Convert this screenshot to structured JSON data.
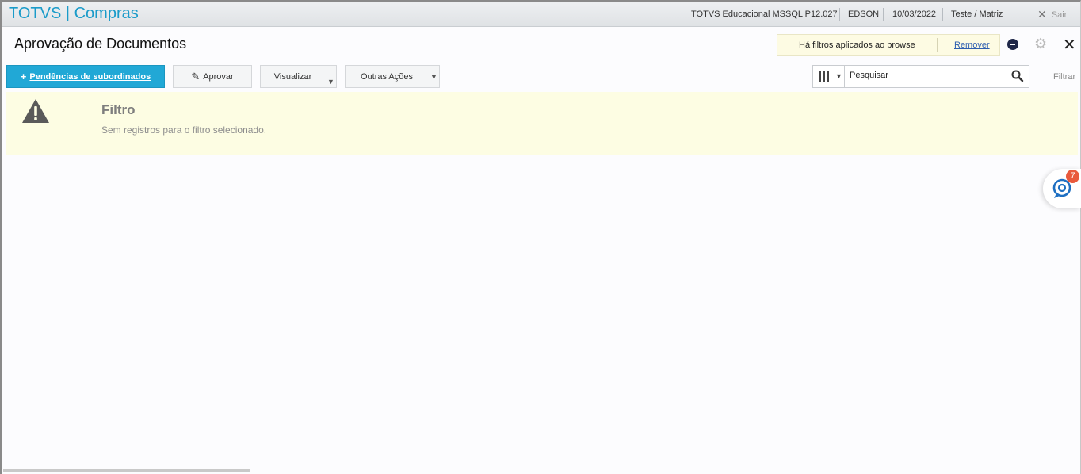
{
  "header": {
    "app_title": "TOTVS | Compras",
    "environment": "TOTVS Educacional MSSQL P12.027",
    "user": "EDSON",
    "date": "10/03/2022",
    "company": "Teste / Matriz",
    "exit_label": "Sair"
  },
  "page": {
    "title": "Aprovação de Documentos",
    "filter_notice": "Há filtros aplicados ao browse",
    "remove_link": "Remover"
  },
  "toolbar": {
    "pending_label": "Pendências de subordinados",
    "approve_label": "Aprovar",
    "view_label": "Visualizar",
    "other_actions_label": "Outras Ações"
  },
  "search": {
    "value": "Pesquisar",
    "filter_label": "Filtrar"
  },
  "banner": {
    "title": "Filtro",
    "message": "Sem registros para o filtro selecionado."
  },
  "chat": {
    "badge_count": "7"
  },
  "colors": {
    "brand": "#1a9bc9",
    "primary_button": "#21a8d6",
    "banner_background": "#fdfde3",
    "badge": "#e95a3d"
  },
  "icons": [
    "plus-icon",
    "pencil-icon",
    "columns-icon",
    "search-icon",
    "warning-icon",
    "gear-icon",
    "close-icon",
    "chat-icon"
  ]
}
